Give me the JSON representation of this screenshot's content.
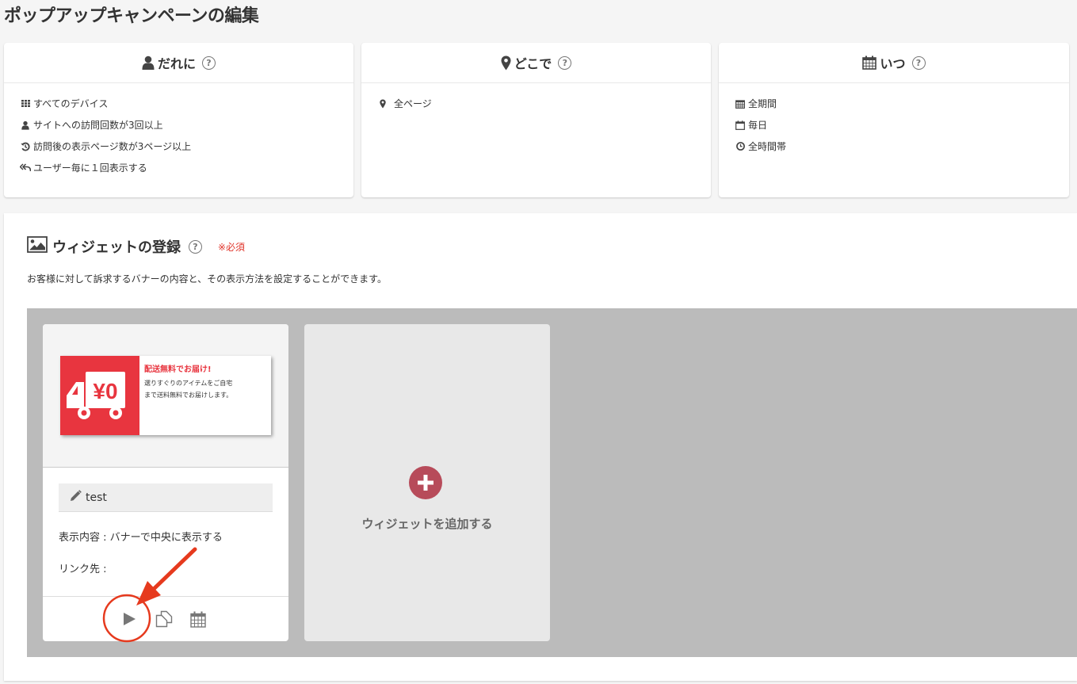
{
  "page": {
    "title": "ポップアップキャンペーンの編集"
  },
  "who": {
    "title": "だれに",
    "help_icon": "question-circle-icon",
    "items": [
      {
        "icon": "grid-icon",
        "label": "すべてのデバイス"
      },
      {
        "icon": "user-icon",
        "label": "サイトへの訪問回数が3回以上"
      },
      {
        "icon": "history-icon",
        "label": "訪問後の表示ページ数が3ページ以上"
      },
      {
        "icon": "reply-all-icon",
        "label": "ユーザー毎に１回表示する"
      }
    ]
  },
  "where": {
    "title": "どこで",
    "help_icon": "question-circle-icon",
    "items": [
      {
        "icon": "map-marker-icon",
        "label": "全ページ"
      }
    ]
  },
  "when": {
    "title": "いつ",
    "help_icon": "question-circle-icon",
    "items": [
      {
        "icon": "calendar-icon",
        "label": "全期間"
      },
      {
        "icon": "calendar-empty-icon",
        "label": "毎日"
      },
      {
        "icon": "clock-icon",
        "label": "全時間帯"
      }
    ]
  },
  "widgets": {
    "title": "ウィジェットの登録",
    "required": "※必須",
    "description": "お客様に対して訴求するバナーの内容と、その表示方法を設定することができます。",
    "items": [
      {
        "banner": {
          "heading": "配送無料でお届け!",
          "line1": "選りすぐりのアイテムをご自宅",
          "line2": "まで送料無料でお届けします。",
          "price_badge": "¥0"
        },
        "name": "test",
        "display": "表示内容 : バナーで中央に表示する",
        "link": "リンク先 :",
        "actions": [
          "play-icon",
          "copy-icon",
          "calendar-icon"
        ]
      }
    ],
    "add_label": "ウィジェットを追加する"
  },
  "colors": {
    "accent_red": "#e8353f",
    "add_button": "#b74b5a",
    "annotation": "#e63a1e"
  }
}
